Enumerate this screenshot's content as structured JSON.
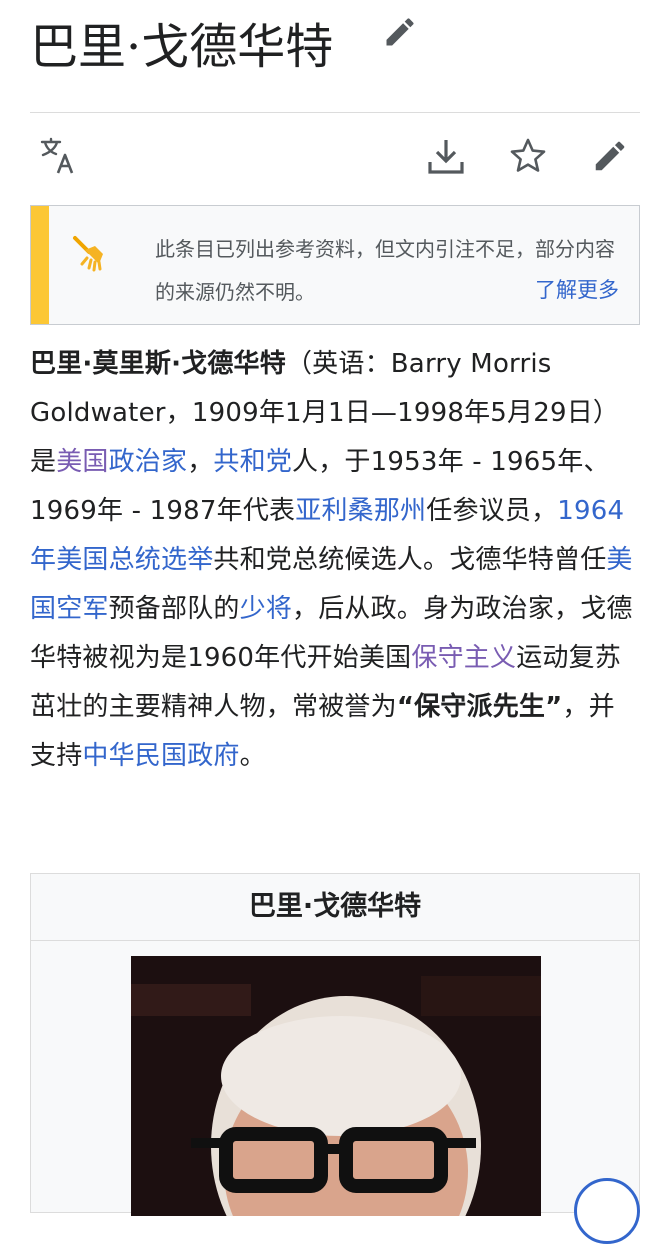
{
  "article": {
    "title": "巴里·戈德华特"
  },
  "toolbar": {
    "language_icon": "translate-icon",
    "download_icon": "download-icon",
    "watch_icon": "star-icon",
    "edit_icon": "pencil-icon"
  },
  "notice": {
    "icon": "broom-icon",
    "text": "此条目已列出参考资料，但文内引注不足，部分内容的来源仍然不明。",
    "link": "了解更多",
    "accent_color": "#fcc735"
  },
  "lead": {
    "name_bold": "巴里·莫里斯·戈德华特",
    "t1": "（英语：Barry Morris Goldwater，1909年1月1日—1998年5月29日）是",
    "l_meiguo": "美国",
    "l_zhengzhijia": "政治家",
    "t2": "，",
    "l_gonghedang": "共和党",
    "t3": "人，于1953年 - 1965年、1969年 - 1987年代表",
    "l_arizona": "亚利桑那州",
    "t4": "任参议员，",
    "l_1964": "1964年美国总统选举",
    "t5": "共和党总统候选人。戈德华特曾任",
    "l_airforce": "美国空军",
    "t6": "预备部队的",
    "l_general": "少将",
    "t7": "，后从政。身为政治家，戈德华特被视为是1960年代开始美国",
    "l_conservatism": "保守主义",
    "t8": "运动复苏茁壮的主要精神人物，常被誉为",
    "q_mr": "“保守派先生”",
    "t9": "，并支持",
    "l_roc": "中华民国政府",
    "t10": "。",
    "link_color": "#3366cc",
    "visited_color": "#795cb2"
  },
  "infobox": {
    "title": "巴里·戈德华特"
  }
}
